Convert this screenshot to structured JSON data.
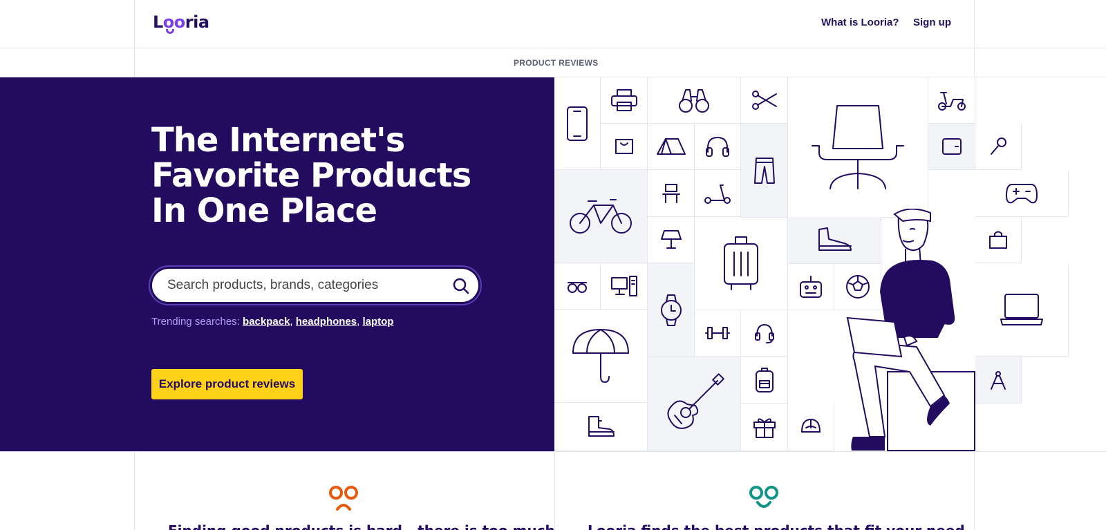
{
  "header": {
    "logo": "Looria",
    "nav": [
      {
        "label": "What is Looria?"
      },
      {
        "label": "Sign up"
      }
    ]
  },
  "subbar": {
    "label": "PRODUCT REVIEWS"
  },
  "hero": {
    "title": "The Internet's Favorite Products In One Place",
    "search": {
      "placeholder": "Search products, brands, categories"
    },
    "trending": {
      "prefix": "Trending searches:",
      "items": [
        "backpack",
        "headphones",
        "laptop"
      ]
    },
    "cta_label": "Explore product reviews"
  },
  "illustration_icons": [
    "phone-icon",
    "printer-icon",
    "binoculars-icon",
    "scissors-icon",
    "chair-icon",
    "scooter-icon",
    "bag-icon",
    "tent-icon",
    "headphones-icon",
    "pants-icon",
    "wallet-icon",
    "microphone-icon",
    "bicycle-icon",
    "stool-icon",
    "kick-scooter-icon",
    "gamepad-icon",
    "lamp-icon",
    "suitcase-icon",
    "sneaker-icon",
    "shopping-bag-icon",
    "glasses-icon",
    "desktop-icon",
    "watch-icon",
    "radio-icon",
    "football-icon",
    "laptop-icon",
    "umbrella-icon",
    "dumbbell-icon",
    "headset-icon",
    "guitar-icon",
    "backpack-icon",
    "compass-icon",
    "boot-icon",
    "gift-icon",
    "cap-icon",
    "person-with-laptop-illustration"
  ],
  "bottom": {
    "left_face_color": "#e8590c",
    "right_face_color": "#0f9488",
    "left_text": "Finding good products is hard - there is too much",
    "right_text": "Looria finds the best products that fit your need"
  },
  "colors": {
    "brand_dark": "#230b5f",
    "brand_purple": "#7b3fe4",
    "cta_yellow": "#ffd118"
  }
}
